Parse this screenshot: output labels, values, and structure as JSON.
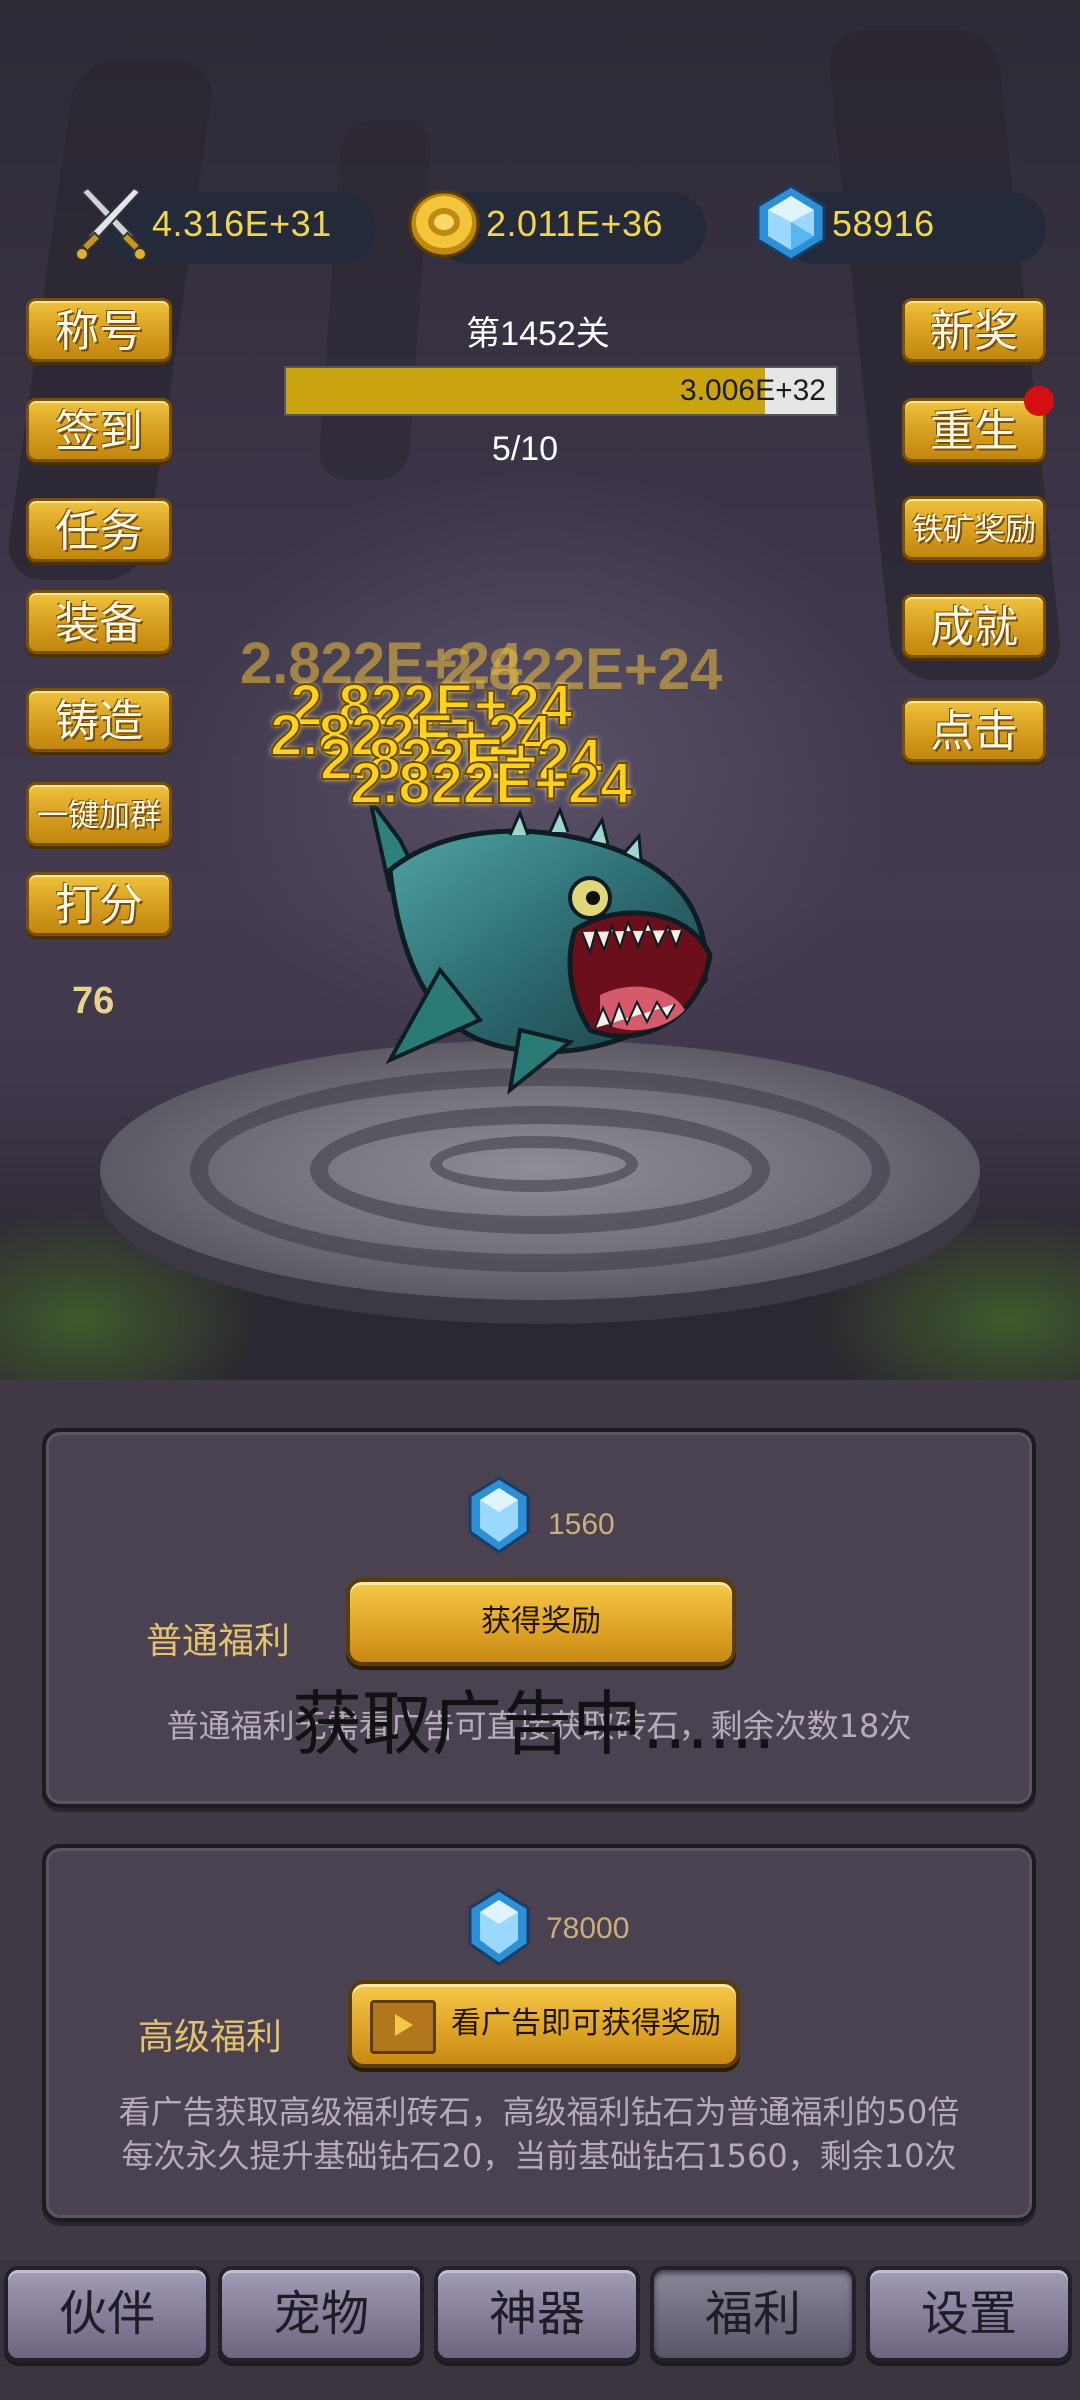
{
  "resources": {
    "power": {
      "icon": "crossed-swords-icon",
      "value": "4.316E+31"
    },
    "gold": {
      "icon": "gold-coin-icon",
      "value": "2.011E+36"
    },
    "diamond": {
      "icon": "diamond-icon",
      "value": "58916"
    }
  },
  "level": {
    "title": "第1452关",
    "boss_hp_text": "3.006E+32",
    "boss_hp_fraction": 0.87,
    "wave": "5/10"
  },
  "left_menu": {
    "title": "称号",
    "checkin": "签到",
    "tasks": "任务",
    "equipment": "装备",
    "forge": "铸造",
    "join_group": "一键加群",
    "rate": "打分"
  },
  "right_menu": {
    "new_reward": "新奖",
    "rebirth": "重生",
    "iron_reward": "铁矿奖励",
    "achievement": "成就",
    "click": "点击"
  },
  "score": "76",
  "damage_popup": "2.822E+24",
  "welfare": {
    "normal": {
      "amount": "1560",
      "label": "普通福利",
      "button": "获得奖励",
      "description": "普通福利无需看广告可直接获取砖石，剩余次数18次"
    },
    "premium": {
      "amount": "78000",
      "label": "高级福利",
      "button": "看广告即可获得奖励",
      "description_line1": "看广告获取高级福利砖石，高级福利钻石为普通福利的50倍",
      "description_line2": "每次永久提升基础钻石20，当前基础钻石1560，剩余10次"
    },
    "loading_toast": "获取广告中......"
  },
  "tabs": {
    "partner": "伙伴",
    "pet": "宠物",
    "artifact": "神器",
    "welfare": "福利",
    "settings": "设置",
    "active": "welfare"
  },
  "colors": {
    "gold_button": "#d8a021",
    "hp_fill": "#c9a410",
    "resource_text": "#f2d64c"
  }
}
